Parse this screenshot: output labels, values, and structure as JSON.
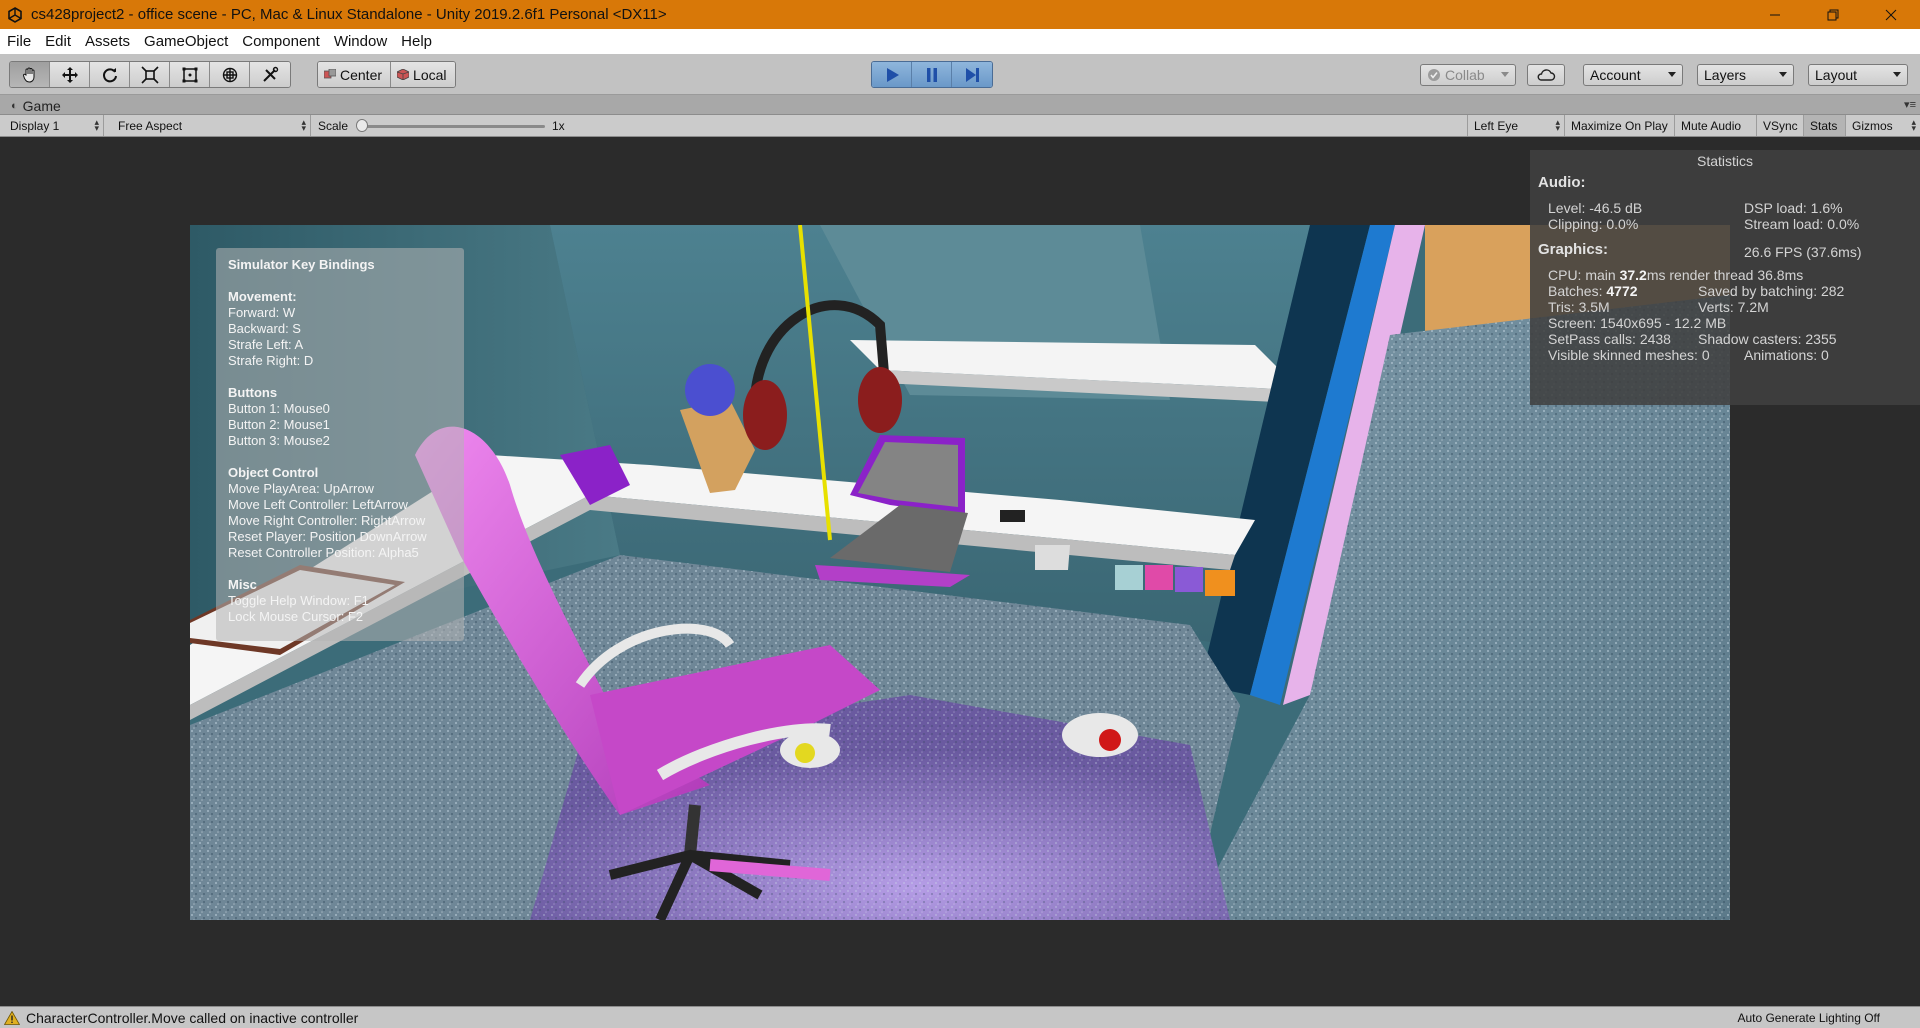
{
  "window": {
    "title": "cs428project2 - office scene - PC, Mac & Linux Standalone - Unity 2019.2.6f1 Personal <DX11>",
    "controls": [
      "minimize",
      "restore",
      "close"
    ]
  },
  "menu": [
    "File",
    "Edit",
    "Assets",
    "GameObject",
    "Component",
    "Window",
    "Help"
  ],
  "toolbar": {
    "tools": [
      "hand-icon",
      "move-icon",
      "rotate-icon",
      "scale-icon",
      "rect-icon",
      "transform-icon",
      "custom-tool-icon"
    ],
    "pivot": {
      "center": "Center",
      "local": "Local"
    },
    "collab": "Collab",
    "account": "Account",
    "layers": "Layers",
    "layout": "Layout"
  },
  "tab": {
    "label": "Game"
  },
  "gamebar": {
    "display": "Display 1",
    "aspect": "Free Aspect",
    "scale_label": "Scale",
    "scale_value": "1x",
    "eye": "Left Eye",
    "maximize": "Maximize On Play",
    "mute": "Mute Audio",
    "vsync": "VSync",
    "stats": "Stats",
    "gizmos": "Gizmos"
  },
  "keybindings": {
    "title": "Simulator Key Bindings",
    "sections": [
      {
        "head": "Movement:",
        "lines": [
          "Forward: W",
          "Backward: S",
          "Strafe Left: A",
          "Strafe Right: D"
        ]
      },
      {
        "head": "Buttons",
        "lines": [
          "Button 1: Mouse0",
          "Button 2: Mouse1",
          "Button 3: Mouse2"
        ]
      },
      {
        "head": "Object Control",
        "lines": [
          "Move PlayArea: UpArrow",
          "Move Left Controller: LeftArrow",
          "Move Right Controller: RightArrow",
          "Reset Player: Position DownArrow",
          "Reset Controller Position: Alpha5"
        ]
      },
      {
        "head": "Misc",
        "lines": [
          "Toggle Help Window: F1",
          "Lock Mouse Cursor: F2"
        ]
      }
    ]
  },
  "stats": {
    "title": "Statistics",
    "audio_head": "Audio:",
    "level": "Level: -46.5 dB",
    "clipping": "Clipping: 0.0%",
    "dsp": "DSP load: 1.6%",
    "stream": "Stream load: 0.0%",
    "graphics_head": "Graphics:",
    "fps": "26.6 FPS (37.6ms)",
    "cpu_prefix": "CPU: main ",
    "cpu_main": "37.2",
    "cpu_suffix": "ms  render thread 36.8ms",
    "batches_prefix": "Batches: ",
    "batches": "4772",
    "saved": "Saved by batching: 282",
    "tris": "Tris: 3.5M",
    "verts": "Verts: 7.2M",
    "screen": "Screen: 1540x695 - 12.2 MB",
    "setpass": "SetPass calls: 2438",
    "shadow": "Shadow casters: 2355",
    "skinned": "Visible skinned meshes: 0",
    "animations": "Animations: 0"
  },
  "status": {
    "message": "CharacterController.Move called on inactive controller",
    "right": "Auto Generate Lighting Off"
  }
}
